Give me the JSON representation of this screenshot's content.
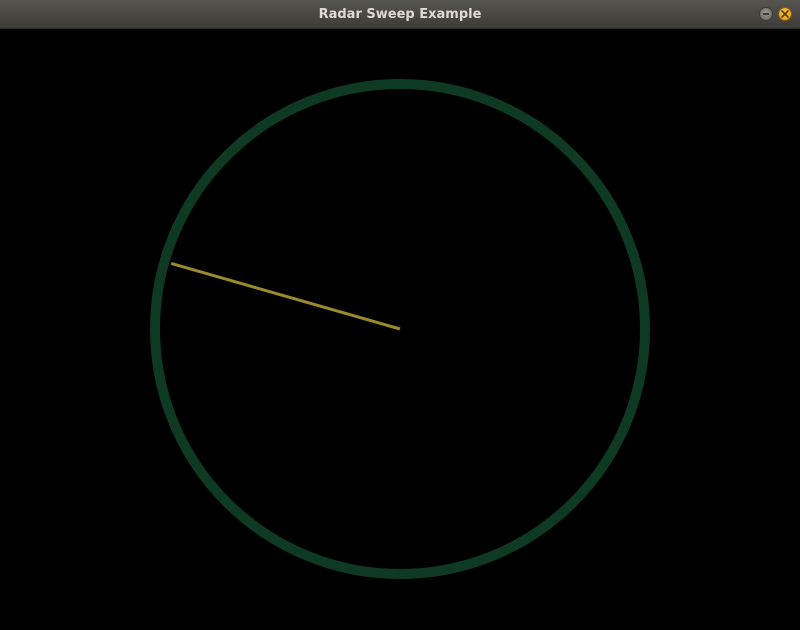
{
  "window": {
    "title": "Radar Sweep Example",
    "buttons": {
      "minimize_icon": "minimize-icon",
      "close_icon": "close-icon"
    }
  },
  "radar": {
    "background_color": "#000000",
    "ring_color": "#0e3a24",
    "sweep_color": "#9c8a2a",
    "sweep_angle_deg": 164
  }
}
